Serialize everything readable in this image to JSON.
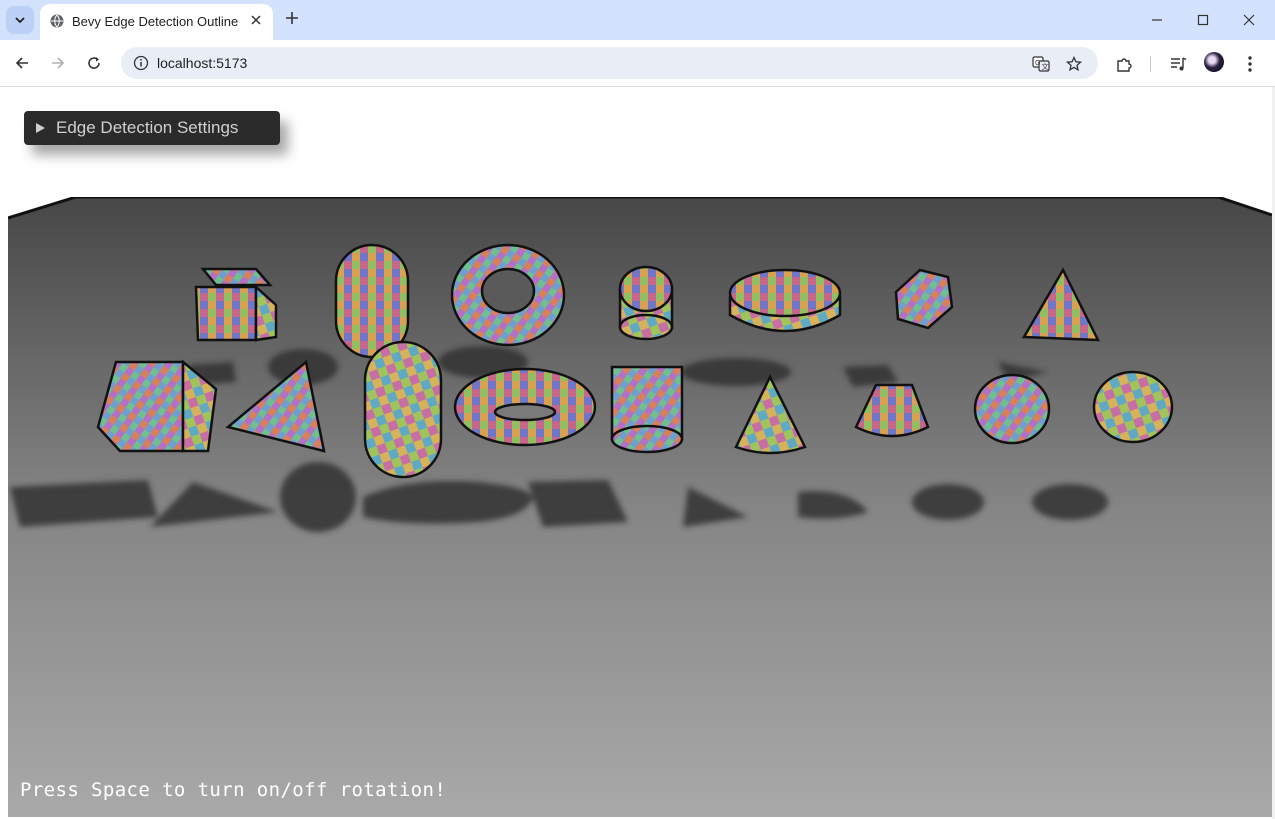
{
  "browser": {
    "tab_title": "Bevy Edge Detection Outline",
    "url": "localhost:5173",
    "icons": {
      "tab_search": "chevron-down-icon",
      "favicon": "globe-icon",
      "tab_close": "close-icon",
      "new_tab": "plus-icon",
      "minimize": "minimize-icon",
      "maximize": "maximize-icon",
      "window_close": "close-icon",
      "back": "back-arrow-icon",
      "forward": "forward-arrow-icon",
      "reload": "reload-icon",
      "site_info": "info-icon",
      "translate": "translate-icon",
      "bookmark": "star-icon",
      "extensions": "puzzle-icon",
      "media": "media-control-icon",
      "profile": "avatar",
      "menu": "more-vertical-icon"
    }
  },
  "page": {
    "settings_label": "Edge Detection Settings",
    "hint": "Press Space to turn on/off rotation!"
  },
  "colors": {
    "tab_strip": "#d3e3fd",
    "omnibox": "#e9eef6",
    "panel": "#2b2b2b",
    "panel_text": "#d0d0d0",
    "scene_far": "#4a4a4a",
    "scene_near": "#a8a8a8"
  }
}
